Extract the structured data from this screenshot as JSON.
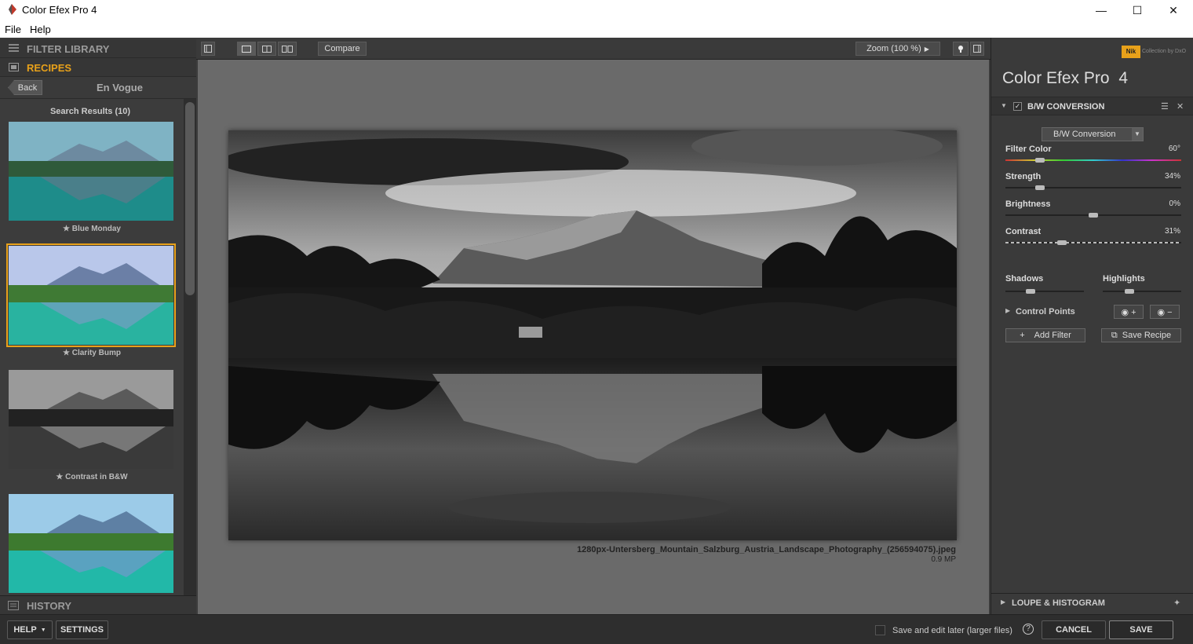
{
  "window": {
    "title": "Color Efex Pro 4",
    "minimize": "—",
    "maximize": "☐",
    "close": "✕"
  },
  "menu": {
    "file": "File",
    "help": "Help"
  },
  "left_panel": {
    "filter_library": "FILTER LIBRARY",
    "recipes": "RECIPES",
    "back": "Back",
    "folder": "En Vogue",
    "search_results": "Search Results (10)",
    "recipes_list": [
      {
        "label": "★ Blue Monday"
      },
      {
        "label": "★ Clarity Bump"
      },
      {
        "label": "★ Contrast in B&W"
      },
      {
        "label": ""
      }
    ],
    "history": "HISTORY"
  },
  "toolbar": {
    "compare": "Compare",
    "zoom": "Zoom (100 %)"
  },
  "image": {
    "filename": "1280px-Untersberg_Mountain_Salzburg_Austria_Landscape_Photography_(256594075).jpeg",
    "size": "0.9 MP"
  },
  "right_panel": {
    "nik_badge": "Nik",
    "nik_tagline": "Collection by DxO",
    "brand": "Color Efex Pro",
    "brand_version": "4",
    "filter_name": "B/W CONVERSION",
    "filter_enabled_mark": "✓",
    "method": "B/W Conversion",
    "sliders": [
      {
        "label": "Filter Color",
        "value": "60°",
        "level": 0.18
      },
      {
        "label": "Strength",
        "value": "34%",
        "level": 0.18
      },
      {
        "label": "Brightness",
        "value": "0%",
        "level": 0.5
      },
      {
        "label": "Contrast",
        "value": "31%",
        "level": 0.31
      }
    ],
    "shadows": "Shadows",
    "highlights": "Highlights",
    "control_points": "Control Points",
    "add_filter": "Add Filter",
    "save_recipe": "Save Recipe",
    "loupe": "LOUPE & HISTOGRAM"
  },
  "bottom": {
    "help": "HELP",
    "settings": "SETTINGS",
    "save_later": "Save and edit later (larger files)",
    "help_icon": "?",
    "cancel": "CANCEL",
    "save": "SAVE"
  },
  "colors": {
    "accent": "#e8a11a",
    "panel": "#3a3a3a",
    "canvas": "#6a6a6a"
  }
}
